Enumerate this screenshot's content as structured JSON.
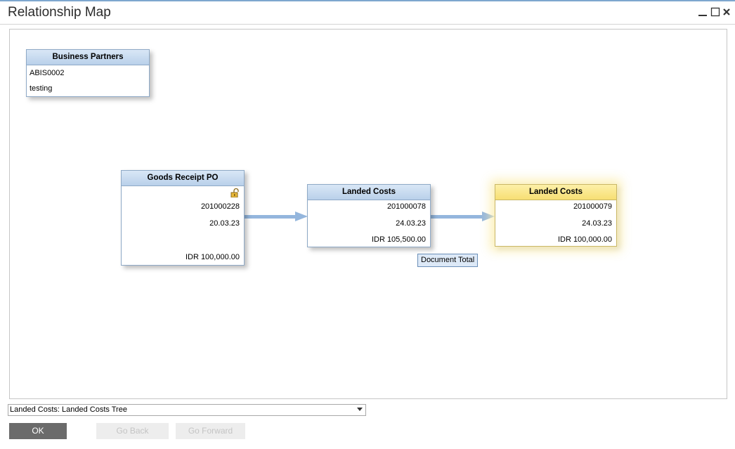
{
  "window": {
    "title": "Relationship Map"
  },
  "cards": {
    "business_partners": {
      "header": "Business Partners",
      "code": "ABIS0002",
      "name": "testing"
    },
    "goods_receipt": {
      "header": "Goods Receipt PO",
      "number": "201000228",
      "date": "20.03.23",
      "total": "IDR 100,000.00"
    },
    "landed_costs_1": {
      "header": "Landed Costs",
      "number": "201000078",
      "date": "24.03.23",
      "total": "IDR 105,500.00"
    },
    "landed_costs_2": {
      "header": "Landed Costs",
      "number": "201000079",
      "date": "24.03.23",
      "total": "IDR 100,000.00"
    }
  },
  "tooltip": {
    "text": "Document Total"
  },
  "tree_selector": {
    "value": "Landed Costs: Landed Costs Tree"
  },
  "buttons": {
    "ok": "OK",
    "go_back": "Go Back",
    "go_forward": "Go Forward"
  },
  "colors": {
    "accent": "#7ea7cf",
    "card_header": "#c9dcf1",
    "selected_header": "#fbe78e",
    "connector": "#94b6dd"
  },
  "icons": {
    "lock": "open-lock-icon",
    "minimize": "minimize-icon",
    "maximize": "maximize-icon",
    "close": "close-icon",
    "dropdown": "chevron-down-icon"
  }
}
